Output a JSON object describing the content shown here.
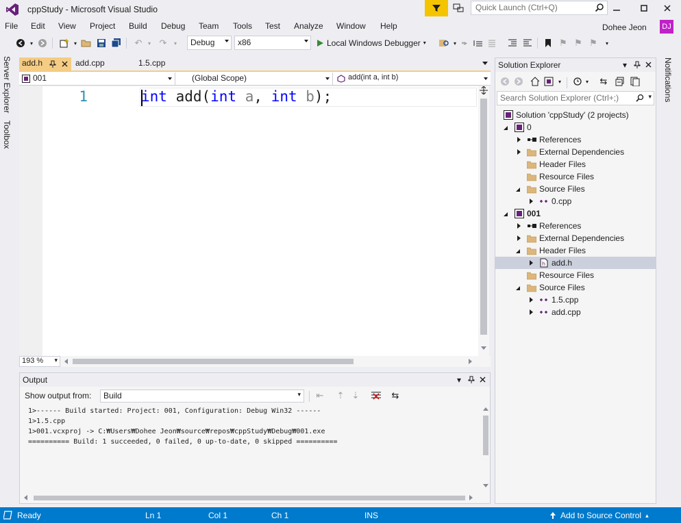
{
  "window": {
    "title": "cppStudy - Microsoft Visual Studio",
    "quick_launch_placeholder": "Quick Launch (Ctrl+Q)",
    "user_name": "Dohee Jeon",
    "user_initials": "DJ"
  },
  "menu": [
    "File",
    "Edit",
    "View",
    "Project",
    "Build",
    "Debug",
    "Team",
    "Tools",
    "Test",
    "Analyze",
    "Window",
    "Help"
  ],
  "toolbar": {
    "configuration": "Debug",
    "platform": "x86",
    "run_label": "Local Windows Debugger"
  },
  "left_rail": [
    "Server Explorer",
    "Toolbox"
  ],
  "right_rail": [
    "Notifications"
  ],
  "editor": {
    "tabs": [
      {
        "label": "add.h",
        "active": true
      },
      {
        "label": "add.cpp",
        "active": false
      },
      {
        "label": "1.5.cpp",
        "active": false
      }
    ],
    "nav": {
      "project": "001",
      "scope": "(Global Scope)",
      "member": "add(int a, int b)"
    },
    "line_number": "1",
    "code_tokens": {
      "kw1": "int",
      "fn": " add(",
      "kw2": "int",
      "p1": " a",
      "sep": ", ",
      "kw3": "int",
      "p2": " b",
      "end": ");"
    },
    "zoom": "193 %"
  },
  "output": {
    "title": "Output",
    "show_from_label": "Show output from:",
    "source": "Build",
    "lines": [
      "1>------ Build started: Project: 001, Configuration: Debug Win32 ------",
      "1>1.5.cpp",
      "1>001.vcxproj -> C:₩Users₩Dohee Jeon₩source₩repos₩cppStudy₩Debug₩001.exe",
      "========== Build: 1 succeeded, 0 failed, 0 up-to-date, 0 skipped =========="
    ]
  },
  "solution_explorer": {
    "title": "Solution Explorer",
    "search_placeholder": "Search Solution Explorer (Ctrl+;)",
    "tree": [
      {
        "label": "Solution 'cppStudy' (2 projects)",
        "indent": 0,
        "expander": "none",
        "icon": "solution"
      },
      {
        "label": "0",
        "indent": 1,
        "expander": "open",
        "icon": "project"
      },
      {
        "label": "References",
        "indent": 2,
        "expander": "closed",
        "icon": "references"
      },
      {
        "label": "External Dependencies",
        "indent": 2,
        "expander": "closed",
        "icon": "folder"
      },
      {
        "label": "Header Files",
        "indent": 2,
        "expander": "none",
        "icon": "folder"
      },
      {
        "label": "Resource Files",
        "indent": 2,
        "expander": "none",
        "icon": "folder"
      },
      {
        "label": "Source Files",
        "indent": 2,
        "expander": "open",
        "icon": "folder"
      },
      {
        "label": "0.cpp",
        "indent": 3,
        "expander": "closed",
        "icon": "cpp"
      },
      {
        "label": "001",
        "indent": 1,
        "expander": "open",
        "icon": "project",
        "bold": true
      },
      {
        "label": "References",
        "indent": 2,
        "expander": "closed",
        "icon": "references"
      },
      {
        "label": "External Dependencies",
        "indent": 2,
        "expander": "closed",
        "icon": "folder"
      },
      {
        "label": "Header Files",
        "indent": 2,
        "expander": "open",
        "icon": "folder"
      },
      {
        "label": "add.h",
        "indent": 3,
        "expander": "closed",
        "icon": "header",
        "selected": true
      },
      {
        "label": "Resource Files",
        "indent": 2,
        "expander": "none",
        "icon": "folder"
      },
      {
        "label": "Source Files",
        "indent": 2,
        "expander": "open",
        "icon": "folder"
      },
      {
        "label": "1.5.cpp",
        "indent": 3,
        "expander": "closed",
        "icon": "cpp"
      },
      {
        "label": "add.cpp",
        "indent": 3,
        "expander": "closed",
        "icon": "cpp"
      }
    ]
  },
  "status": {
    "state": "Ready",
    "line": "Ln 1",
    "col": "Col 1",
    "ch": "Ch 1",
    "mode": "INS",
    "source_control": "Add to Source Control"
  },
  "colors": {
    "status_bar": "#007acc",
    "active_tab": "#f5cc84",
    "keyword": "#0000ff",
    "line_number": "#2b91af",
    "vs_purple": "#68217a"
  }
}
